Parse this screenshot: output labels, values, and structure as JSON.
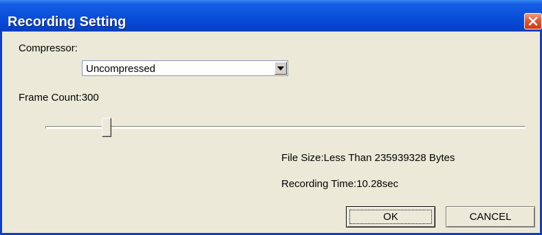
{
  "window": {
    "title": "Recording Setting",
    "close_icon": "close-icon"
  },
  "compressor": {
    "label": "Compressor:",
    "selected": "Uncompressed",
    "arrow_icon": "chevron-down-icon"
  },
  "frame_count": {
    "label": "Frame Count:300",
    "slider_fraction": 0.12
  },
  "info": {
    "file_size": "File Size:Less Than 235939328 Bytes",
    "recording_time": "Recording Time:10.28sec"
  },
  "buttons": {
    "ok": "OK",
    "cancel": "CANCEL"
  },
  "colors": {
    "titlebar": "#0a52db",
    "dialog_bg": "#ece9d8",
    "close_button": "#e05a34"
  }
}
